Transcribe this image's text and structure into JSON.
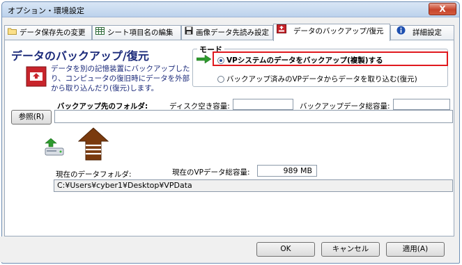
{
  "window": {
    "title": "オプション・環境設定",
    "close_label": "X"
  },
  "tabs": [
    {
      "label": "データ保存先の変更"
    },
    {
      "label": "シート項目名の編集"
    },
    {
      "label": "画像データ先読み設定"
    },
    {
      "label": "データのバックアップ/復元"
    },
    {
      "label": "詳細設定"
    }
  ],
  "main": {
    "heading": "データのバックアップ/復元",
    "description": "データを別の記憶装置にバックアップしたり、コンピュータの復旧時にデータを外部から取り込んだり(復元)します。"
  },
  "mode": {
    "legend": "モード",
    "option_backup": "VPシステムのデータをバックアップ(複製)する",
    "option_restore": "バックアップ済みのVPデータからデータを取り込む(復元)"
  },
  "backup": {
    "folder_label": "バックアップ先のフォルダ:",
    "disk_free_label": "ディスク空き容量:",
    "backup_total_label": "バックアップデータ総容量:",
    "browse_label": "参照(R)",
    "folder_value": ""
  },
  "current": {
    "folder_label": "現在のデータフォルダ:",
    "total_label": "現在のVPデータ総容量:",
    "total_value": "989 MB",
    "path": "C:¥Users¥cyber1¥Desktop¥VPData"
  },
  "buttons": {
    "ok": "OK",
    "cancel": "キャンセル",
    "apply": "適用(A)"
  },
  "colors": {
    "heading": "#1b2a7a",
    "highlight": "#e0191e",
    "arrow": "#7a3a0e",
    "green_arrow": "#2e9a2e"
  }
}
